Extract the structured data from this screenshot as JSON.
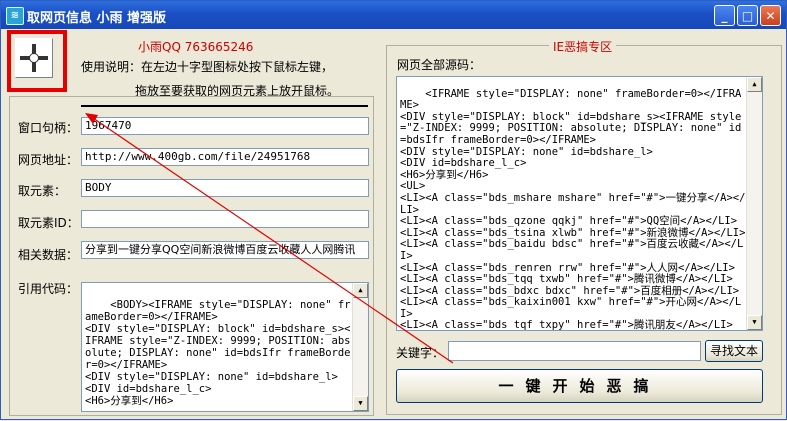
{
  "window": {
    "title": "取网页信息 小雨 增强版",
    "icon": "app-icon",
    "controls": {
      "minimize": "_",
      "maximize": "□",
      "close": "✕"
    }
  },
  "header": {
    "qq_label": "小雨QQ  763665246",
    "usage_line1": "使用说明：在左边十字型图标处按下鼠标左键，",
    "usage_line2": "拖放至要获取的网页元素上放开鼠标。"
  },
  "fields": {
    "handle": {
      "label": "窗口句柄：",
      "value": "1967470"
    },
    "url": {
      "label": "网页地址：",
      "value": "http://www.400gb.com/file/24951768"
    },
    "element": {
      "label": "取元素：",
      "value": "BODY"
    },
    "element_id": {
      "label": "取元素ID：",
      "value": ""
    },
    "related": {
      "label": "相关数据：",
      "value": "分享到一键分享QQ空间新浪微博百度云收藏人人网腾讯"
    },
    "quote_code": {
      "label": "引用代码："
    }
  },
  "quote_code_text": "<BODY><IFRAME style=\"DISPLAY: none\" frameBorder=0></IFRAME>\n<DIV style=\"DISPLAY: block\" id=bdshare_s><IFRAME style=\"Z-INDEX: 9999; POSITION: absolute; DISPLAY: none\" id=bdsIfr frameBorder=0></IFRAME>\n<DIV style=\"DISPLAY: none\" id=bdshare_l>\n<DIV id=bdshare_l_c>\n<H6>分享到</H6>",
  "right_panel": {
    "group_title": "IE恶搞专区",
    "source_label": "网页全部源码：",
    "source_text": "<IFRAME style=\"DISPLAY: none\" frameBorder=0></IFRAME>\n<DIV style=\"DISPLAY: block\" id=bdshare_s><IFRAME style=\"Z-INDEX: 9999; POSITION: absolute; DISPLAY: none\" id=bdsIfr frameBorder=0></IFRAME>\n<DIV style=\"DISPLAY: none\" id=bdshare_l>\n<DIV id=bdshare_l_c>\n<H6>分享到</H6>\n<UL>\n<LI><A class=\"bds_mshare mshare\" href=\"#\">一键分享</A></LI>\n<LI><A class=\"bds_qzone qqkj\" href=\"#\">QQ空间</A></LI>\n<LI><A class=\"bds_tsina xlwb\" href=\"#\">新浪微博</A></LI>\n<LI><A class=\"bds_baidu bdsc\" href=\"#\">百度云收藏</A></LI>\n<LI><A class=\"bds_renren rrw\" href=\"#\">人人网</A></LI>\n<LI><A class=\"bds_tqq txwb\" href=\"#\">腾讯微博</A></LI>\n<LI><A class=\"bds_bdxc bdxc\" href=\"#\">百度相册</A></LI>\n<LI><A class=\"bds_kaixin001 kxw\" href=\"#\">开心网</A></LI>\n<LI><A class=\"bds_tqf txpy\" href=\"#\">腾讯朋友</A></LI>\n<LI><A class=\"bds_tieba bdtb\" href=\"#\">百度贴吧</A></LI>\n<LI><A class=\"bds_douban db\" href=\"#\">豆瓣网</A></LI>",
    "keyword_label": "关键字：",
    "keyword_value": "",
    "find_button": "寻找文本",
    "big_button": "一键开始恶搞"
  },
  "colors": {
    "title_bar": "#1a4fc4",
    "accent_red": "#cc0000",
    "highlight_box": "#e60000",
    "window_bg": "#ece9d8"
  }
}
